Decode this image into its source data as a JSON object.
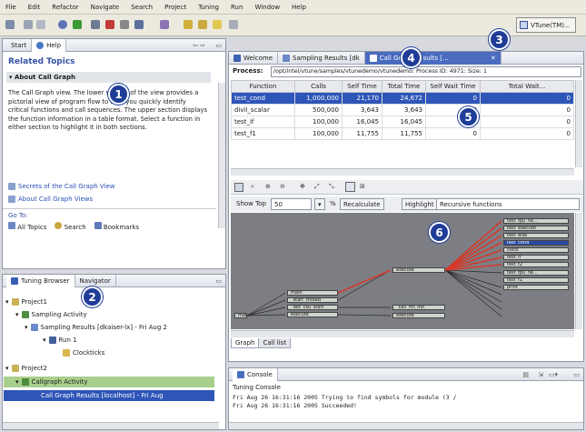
{
  "menu": [
    "File",
    "Edit",
    "Refactor",
    "Navigate",
    "Search",
    "Project",
    "Tuning",
    "Run",
    "Window",
    "Help"
  ],
  "perspective_label": "VTune(TM)...",
  "help": {
    "tab_start": "Start",
    "tab_help": "Help",
    "related": "Related Topics",
    "about_header": "About Call Graph",
    "body": "The Call Graph view.  The lower section of the view provides a pictorial view of program flow to help you quickly identify critical functions and call sequences. The upper section displays the function information in a table format.  Select a function in either section to highlight it in both sections.",
    "link1": "Secrets of the Call Graph View",
    "link2": "About Call Graph Views",
    "goto": "Go To:",
    "all_topics": "All Topics",
    "search": "Search",
    "bookmarks": "Bookmarks"
  },
  "tuning": {
    "tab_browser": "Tuning Browser",
    "tab_navigator": "Navigator",
    "items": [
      "Project1",
      "Sampling Activity",
      "Sampling Results [dkaiser-lx] - Fri Aug 2",
      "Run 1",
      "Clockticks",
      "Project2",
      "Callgraph Activity",
      "Call Graph Results [localhost] - Fri Aug"
    ]
  },
  "editor_tabs": {
    "welcome": "Welcome",
    "sampling": "Sampling Results [dk",
    "callgraph": "Call Graph Results [..."
  },
  "process": {
    "label": "Process:",
    "value": "/opt/intel/vtune/samples/vtunedemo/vtunedemo: Process ID: 4971: Size: 1"
  },
  "table": {
    "columns": [
      "Function",
      "Calls",
      "Self Time",
      "Total Time",
      "Self Wait Time",
      "Total Wait..."
    ],
    "rows": [
      [
        "test_cond",
        "1,000,000",
        "21,170",
        "24,672",
        "0",
        "0"
      ],
      [
        "divil_scalar",
        "500,000",
        "3,643",
        "3,643",
        "0",
        "0"
      ],
      [
        "test_if",
        "100,000",
        "16,045",
        "16,045",
        "0",
        "0"
      ],
      [
        "test_f1",
        "100,000",
        "11,755",
        "11,755",
        "0",
        "0"
      ]
    ]
  },
  "graph_controls": {
    "show_top": "Show Top",
    "show_top_value": "50",
    "percent": "%",
    "recalculate": "Recalculate",
    "highlight": "Highlight",
    "highlight_value": "Recursive functions"
  },
  "graph_nodes": {
    "root": "main",
    "n1": "main",
    "n2": "_start_thread",
    "n3": "_libc_csu_start",
    "n4": "execute",
    "n5": "_call_rtn_init",
    "n6": "execute",
    "r1": "execute",
    "r2": "test_fpu_ne...",
    "r3": "test_execute",
    "r4": "test_else",
    "r5": "test_cond",
    "r6": "clock",
    "r7": "test_if",
    "r8": "test_f2",
    "r9": "test_fpu_ne...",
    "r10": "test_f1",
    "r11": "print"
  },
  "bottom_tabs": {
    "graph": "Graph",
    "calllist": "Call list"
  },
  "console": {
    "tab": "Console",
    "title": "Tuning Console",
    "line1": "Fri Aug 26 16:31:16 2005 Trying to find symbols for module   (3 /",
    "line2": "Fri Aug 26 16:31:16 2005 Succeeded!"
  },
  "badges": [
    "1",
    "2",
    "3",
    "4",
    "5",
    "6"
  ]
}
